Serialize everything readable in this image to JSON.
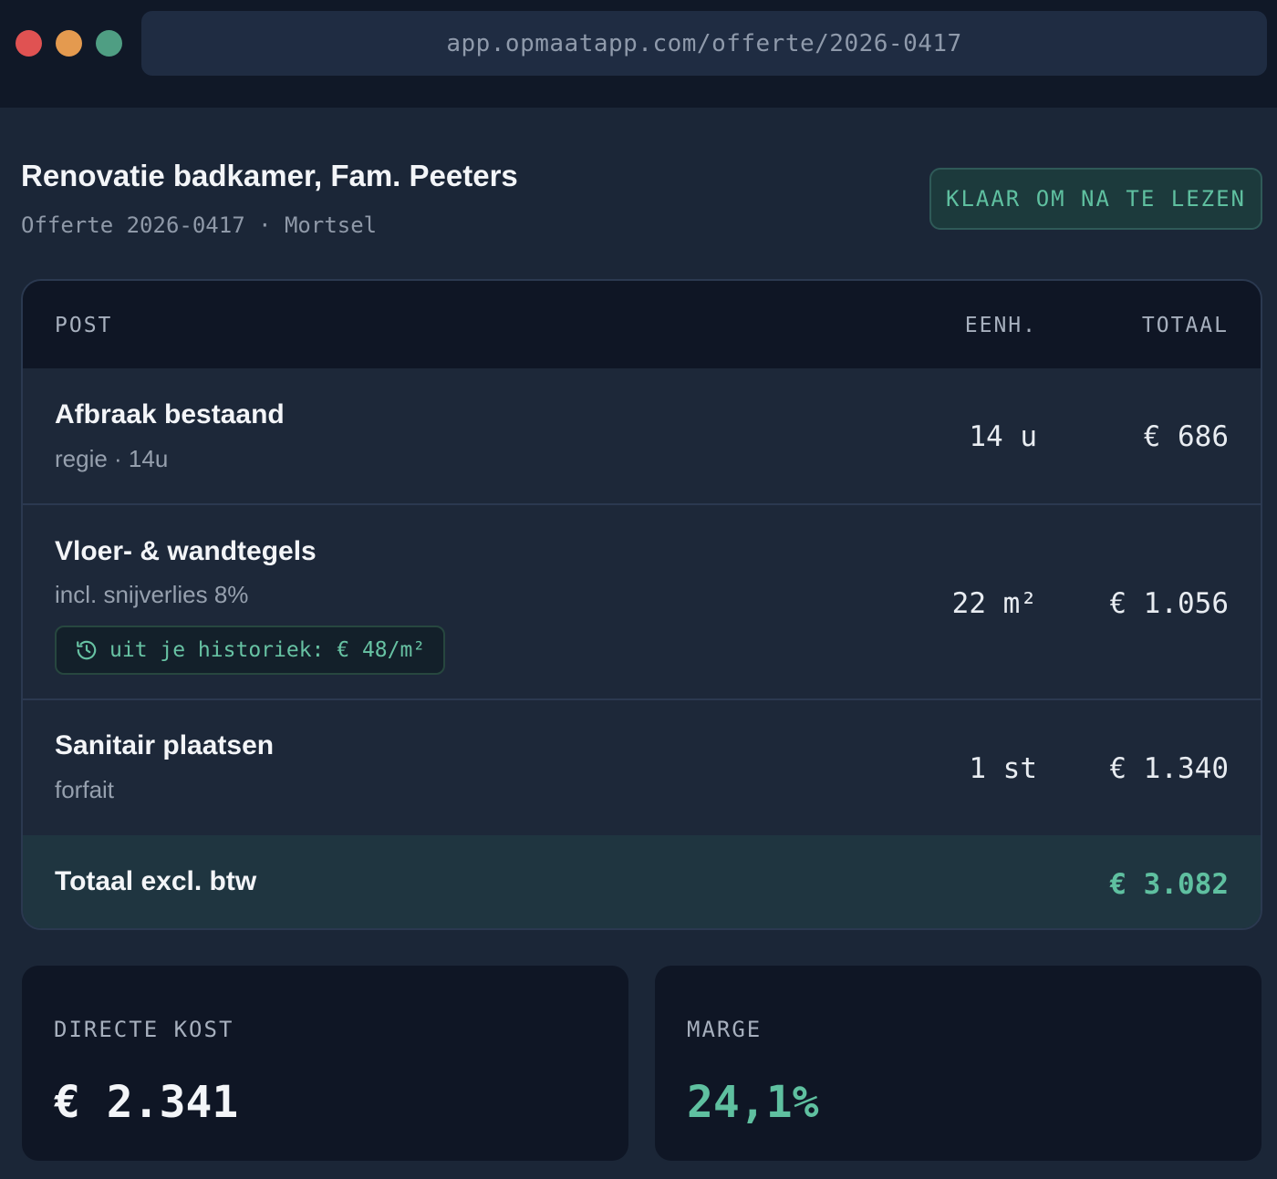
{
  "browser": {
    "url": "app.opmaatapp.com/offerte/2026-0417"
  },
  "header": {
    "title": "Renovatie badkamer, Fam. Peeters",
    "subtitle": "Offerte 2026-0417 · Mortsel",
    "status_button": "KLAAR OM NA TE LEZEN"
  },
  "table": {
    "columns": {
      "post": "POST",
      "eenh": "EENH.",
      "totaal": "TOTAAL"
    },
    "rows": [
      {
        "name": "Afbraak bestaand",
        "note": "regie · 14u",
        "unit": "14 u",
        "total": "€ 686"
      },
      {
        "name": "Vloer- & wandtegels",
        "note": "incl. snijverlies 8%",
        "unit": "22 m²",
        "total": "€ 1.056",
        "history": "uit je historiek: € 48/m²"
      },
      {
        "name": "Sanitair plaatsen",
        "note": "forfait",
        "unit": "1 st",
        "total": "€ 1.340"
      }
    ],
    "total_label": "Totaal excl. btw",
    "total_value": "€ 3.082"
  },
  "summary": {
    "direct_cost_label": "DIRECTE KOST",
    "direct_cost_value": "€ 2.341",
    "margin_label": "MARGE",
    "margin_value": "24,1%"
  },
  "colors": {
    "accent": "#5fc0a0",
    "background": "#1b2637",
    "dot_red": "#e05252",
    "dot_orange": "#e49a4f",
    "dot_green": "#4f9e83"
  },
  "icons": {
    "history": "history-icon"
  }
}
